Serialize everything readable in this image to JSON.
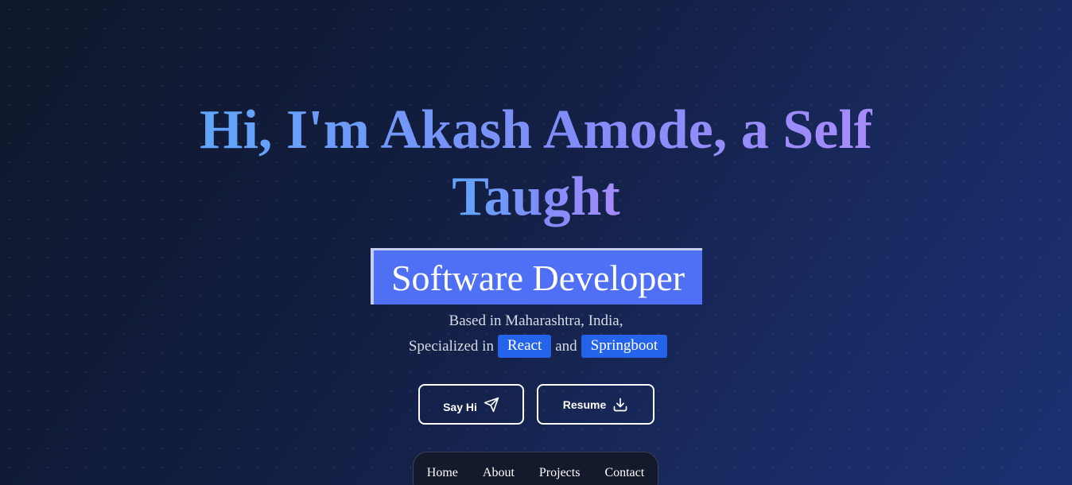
{
  "hero": {
    "title_line1": "Hi, I'm Akash Amode, a Self",
    "title_line2": "Taught",
    "role": "Software Developer",
    "location": "Based in Maharashtra, India,",
    "specialized_prefix": "Specialized in",
    "skill_1": "React",
    "conjunction": "and",
    "skill_2": "Springboot"
  },
  "actions": {
    "say_hi_label": "Say Hi",
    "say_hi_icon": "send-icon",
    "resume_label": "Resume",
    "resume_icon": "download-icon"
  },
  "nav": {
    "items": [
      "Home",
      "About",
      "Projects",
      "Contact"
    ]
  },
  "colors": {
    "background": "#131f44",
    "title_gradient_start": "#60a5fa",
    "title_gradient_end": "#a78bfa",
    "role_box": "#4f6ff5",
    "skill_tag": "#2563eb"
  }
}
